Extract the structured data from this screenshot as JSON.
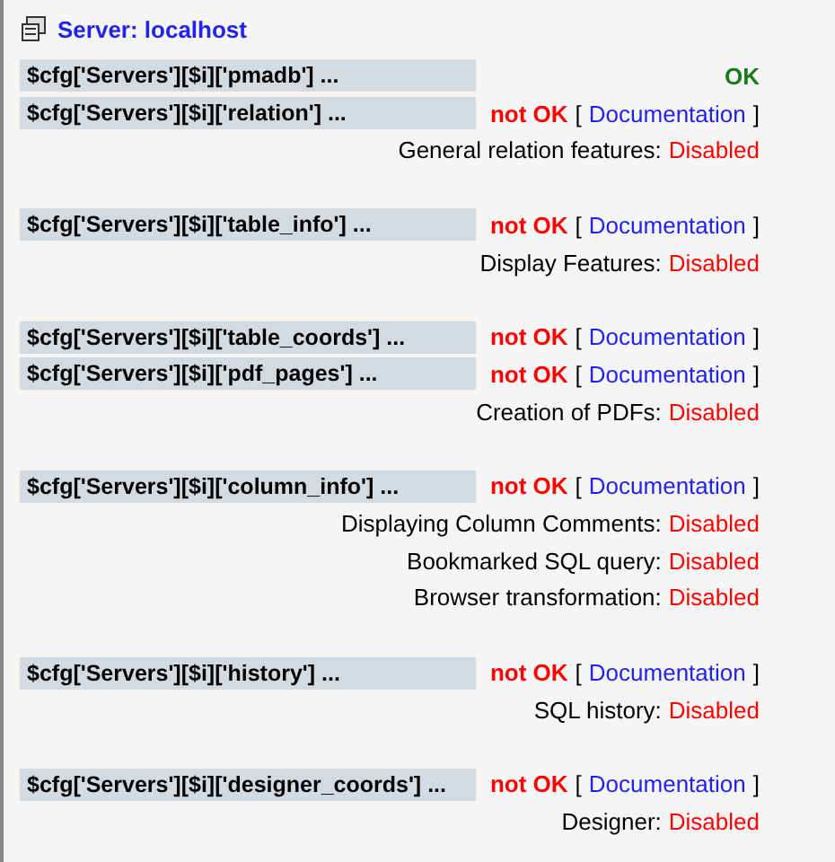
{
  "server": {
    "title": "Server: localhost"
  },
  "groups": [
    {
      "checks": [
        {
          "key": "$cfg['Servers'][$i]['pmadb'] ...",
          "ok": true,
          "status": "OK"
        },
        {
          "key": "$cfg['Servers'][$i]['relation'] ...",
          "ok": false,
          "status": "not OK",
          "open": "[",
          "doc": "Documentation",
          "close": "]"
        }
      ],
      "features": [
        {
          "label": "General relation features:",
          "value": "Disabled"
        }
      ]
    },
    {
      "checks": [
        {
          "key": "$cfg['Servers'][$i]['table_info'] ...",
          "ok": false,
          "status": "not OK",
          "open": "[",
          "doc": "Documentation",
          "close": "]"
        }
      ],
      "features": [
        {
          "label": "Display Features:",
          "value": "Disabled"
        }
      ]
    },
    {
      "checks": [
        {
          "key": "$cfg['Servers'][$i]['table_coords'] ...",
          "ok": false,
          "status": "not OK",
          "open": "[",
          "doc": "Documentation",
          "close": "]"
        },
        {
          "key": "$cfg['Servers'][$i]['pdf_pages'] ...",
          "ok": false,
          "status": "not OK",
          "open": "[",
          "doc": "Documentation",
          "close": "]"
        }
      ],
      "features": [
        {
          "label": "Creation of PDFs:",
          "value": "Disabled"
        }
      ]
    },
    {
      "checks": [
        {
          "key": "$cfg['Servers'][$i]['column_info'] ...",
          "ok": false,
          "status": "not OK",
          "open": "[",
          "doc": "Documentation",
          "close": "]"
        }
      ],
      "features": [
        {
          "label": "Displaying Column Comments:",
          "value": "Disabled"
        },
        {
          "label": "Bookmarked SQL query:",
          "value": "Disabled"
        },
        {
          "label": "Browser transformation:",
          "value": "Disabled"
        }
      ]
    },
    {
      "checks": [
        {
          "key": "$cfg['Servers'][$i]['history'] ...",
          "ok": false,
          "status": "not OK",
          "open": "[",
          "doc": "Documentation",
          "close": "]"
        }
      ],
      "features": [
        {
          "label": "SQL history:",
          "value": "Disabled"
        }
      ]
    },
    {
      "checks": [
        {
          "key": "$cfg['Servers'][$i]['designer_coords'] ...",
          "ok": false,
          "status": "not OK",
          "open": "[",
          "doc": "Documentation",
          "close": "]"
        }
      ],
      "features": [
        {
          "label": "Designer:",
          "value": "Disabled"
        }
      ]
    }
  ]
}
